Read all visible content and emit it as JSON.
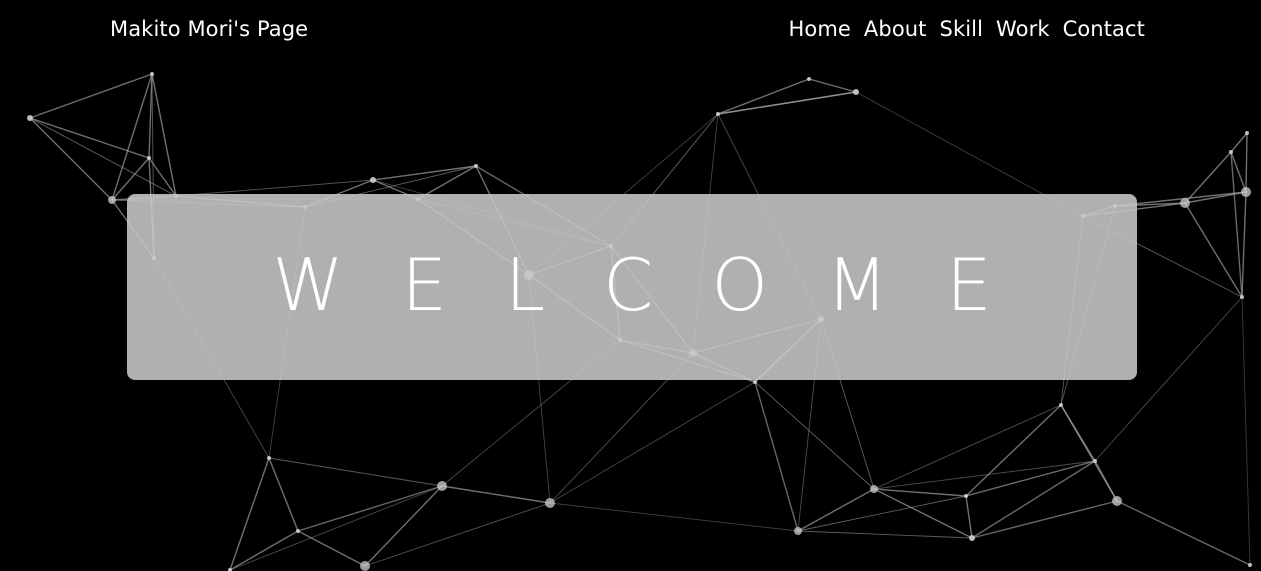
{
  "header": {
    "site_title": "Makito Mori's Page",
    "nav": [
      {
        "label": "Home"
      },
      {
        "label": "About"
      },
      {
        "label": "Skill"
      },
      {
        "label": "Work"
      },
      {
        "label": "Contact"
      }
    ]
  },
  "hero": {
    "welcome_text": "WELCOME"
  },
  "colors": {
    "background": "#000000",
    "text": "#ffffff",
    "banner": "#c8c8c8",
    "network_lines": "#9a9a9a"
  },
  "background_graphic": "particle-network"
}
